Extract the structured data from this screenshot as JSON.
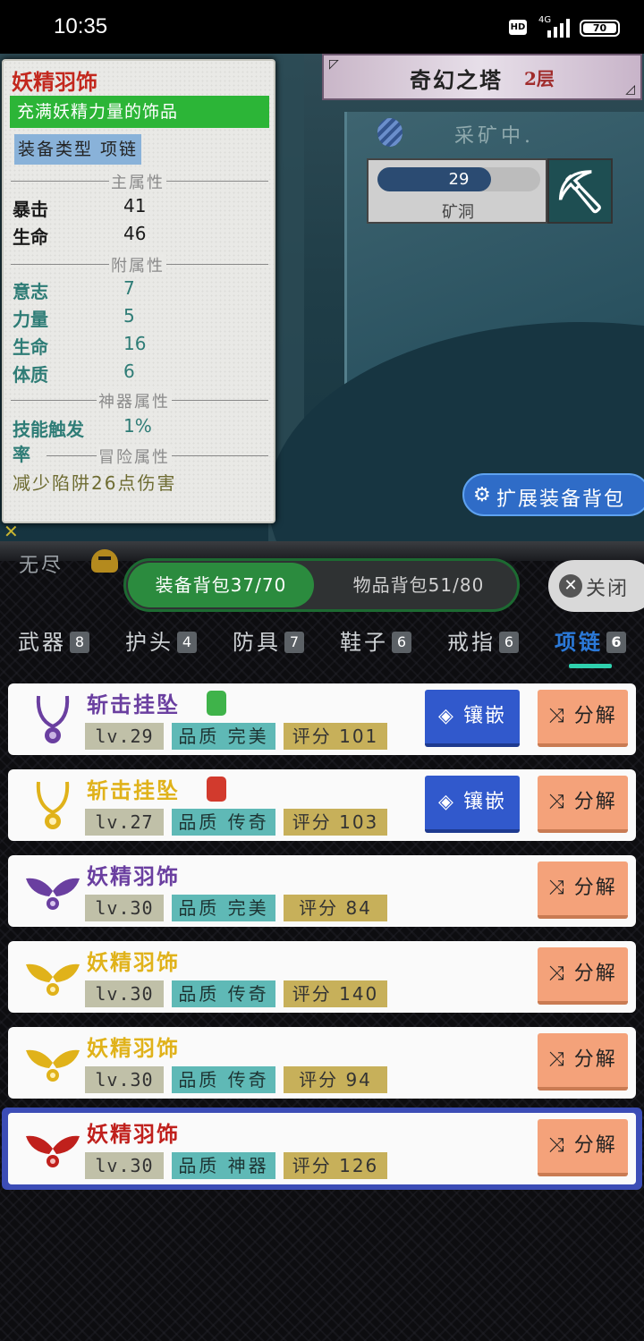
{
  "status_bar": {
    "time": "10:35",
    "hd": "HD",
    "network": "4G",
    "battery": "70"
  },
  "tower": {
    "title": "奇幻之塔",
    "floor": "2层"
  },
  "mining": {
    "status": "采矿中.",
    "progress_value": "29",
    "progress_fraction": 0.7,
    "location": "矿洞"
  },
  "expand_bag_label": "扩展装备背包",
  "tooltip": {
    "name": "妖精羽饰",
    "description": "充满妖精力量的饰品",
    "type_label": "装备类型  项链",
    "main_attr_title": "主属性",
    "main_attrs": [
      {
        "k": "暴击",
        "v": "41"
      },
      {
        "k": "生命",
        "v": "46"
      }
    ],
    "sub_attr_title": "附属性",
    "sub_attrs": [
      {
        "k": "意志",
        "v": "7"
      },
      {
        "k": "力量",
        "v": "5"
      },
      {
        "k": "生命",
        "v": "16"
      },
      {
        "k": "体质",
        "v": "6"
      }
    ],
    "artifact_title": "神器属性",
    "artifact_key": "技能触发率",
    "artifact_key_line1": "技能触发",
    "artifact_key_line2": "率",
    "artifact_value": "1%",
    "adventure_title": "冒险属性",
    "adventure_text": "减少陷阱26点伤害"
  },
  "endless_label": "无尽",
  "bag_tabs": {
    "equipment": "装备背包37/70",
    "items": "物品背包51/80"
  },
  "close_label": "关闭",
  "categories": [
    {
      "label": "武器",
      "count": "8"
    },
    {
      "label": "护头",
      "count": "4"
    },
    {
      "label": "防具",
      "count": "7"
    },
    {
      "label": "鞋子",
      "count": "6"
    },
    {
      "label": "戒指",
      "count": "6"
    },
    {
      "label": "项链",
      "count": "6"
    }
  ],
  "items": [
    {
      "name": "斩击挂坠",
      "color": "#6a3fa0",
      "gem": "#3fb34a",
      "level": "lv.29",
      "quality": "品质 完美",
      "score": "评分 101",
      "embed": "镶嵌",
      "split": "分解"
    },
    {
      "name": "斩击挂坠",
      "color": "#e0b21a",
      "gem": "#d23a2d",
      "level": "lv.27",
      "quality": "品质 传奇",
      "score": "评分 103",
      "embed": "镶嵌",
      "split": "分解"
    },
    {
      "name": "妖精羽饰",
      "color": "#6a3fa0",
      "level": "lv.30",
      "quality": "品质 完美",
      "score": "评分 84",
      "split": "分解"
    },
    {
      "name": "妖精羽饰",
      "color": "#e0b21a",
      "level": "lv.30",
      "quality": "品质 传奇",
      "score": "评分 140",
      "split": "分解"
    },
    {
      "name": "妖精羽饰",
      "color": "#e0b21a",
      "level": "lv.30",
      "quality": "品质 传奇",
      "score": "评分 94",
      "split": "分解"
    },
    {
      "name": "妖精羽饰",
      "color": "#c0201c",
      "level": "lv.30",
      "quality": "品质 神器",
      "score": "评分 126",
      "split": "分解"
    }
  ]
}
